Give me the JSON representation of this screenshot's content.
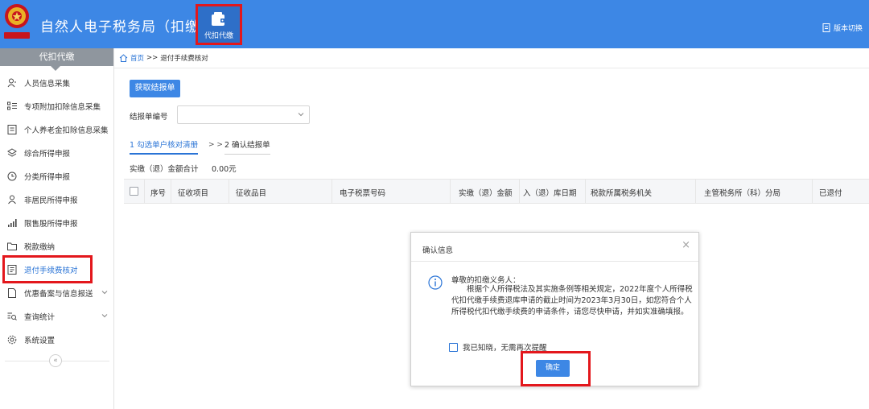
{
  "header": {
    "app_title": "自然人电子税务局（扣缴端）",
    "top_tab_label": "代扣代缴",
    "version_switch": "版本切换",
    "accent_color": "#3d87e5",
    "highlight_color": "#e3171c"
  },
  "sidebar": {
    "title": "代扣代缴",
    "items": [
      {
        "label": "人员信息采集",
        "icon": "person-icon"
      },
      {
        "label": "专项附加扣除信息采集",
        "icon": "list-icon"
      },
      {
        "label": "个人养老金扣除信息采集",
        "icon": "document-icon"
      },
      {
        "label": "综合所得申报",
        "icon": "layers-icon"
      },
      {
        "label": "分类所得申报",
        "icon": "clock-icon"
      },
      {
        "label": "非居民所得申报",
        "icon": "user-alt-icon"
      },
      {
        "label": "限售股所得申报",
        "icon": "bar-signal-icon"
      },
      {
        "label": "税款缴纳",
        "icon": "folder-icon"
      },
      {
        "label": "退付手续费核对",
        "icon": "checklist-icon",
        "active": true
      },
      {
        "label": "优惠备案与信息报送",
        "icon": "file-icon",
        "expandable": true
      },
      {
        "label": "查询统计",
        "icon": "search-list-icon",
        "expandable": true
      },
      {
        "label": "系统设置",
        "icon": "gear-icon"
      }
    ],
    "collapse_label": "«"
  },
  "breadcrumb": {
    "home": "首页",
    "separator": ">>",
    "current": "退付手续费核对"
  },
  "main": {
    "fetch_button": "获取结报单",
    "report_no_label": "结报单编号",
    "report_no_value": "",
    "steps": [
      "1 勾选单户核对清册",
      "2 确认结报单"
    ],
    "step_separator": "> >",
    "total_label": "实缴（退）金额合计",
    "total_value": "0.00元",
    "table_headers": [
      "序号",
      "征收项目",
      "征收品目",
      "电子税票号码",
      "实缴（退）金额",
      "入（退）库日期",
      "税款所属税务机关",
      "主管税务所（科）分局",
      "已退付"
    ]
  },
  "modal": {
    "title": "确认信息",
    "close": "×",
    "greeting": "尊敬的扣缴义务人：",
    "body": "根据个人所得税法及其实施条例等相关规定，2022年度个人所得税代扣代缴手续费退库申请的截止时间为2023年3月30日，如您符合个人所得税代扣代缴手续费的申请条件，请您尽快申请，并如实准确填报。",
    "dismiss_label": "我已知晓，无需再次提醒",
    "confirm_button": "确定"
  }
}
